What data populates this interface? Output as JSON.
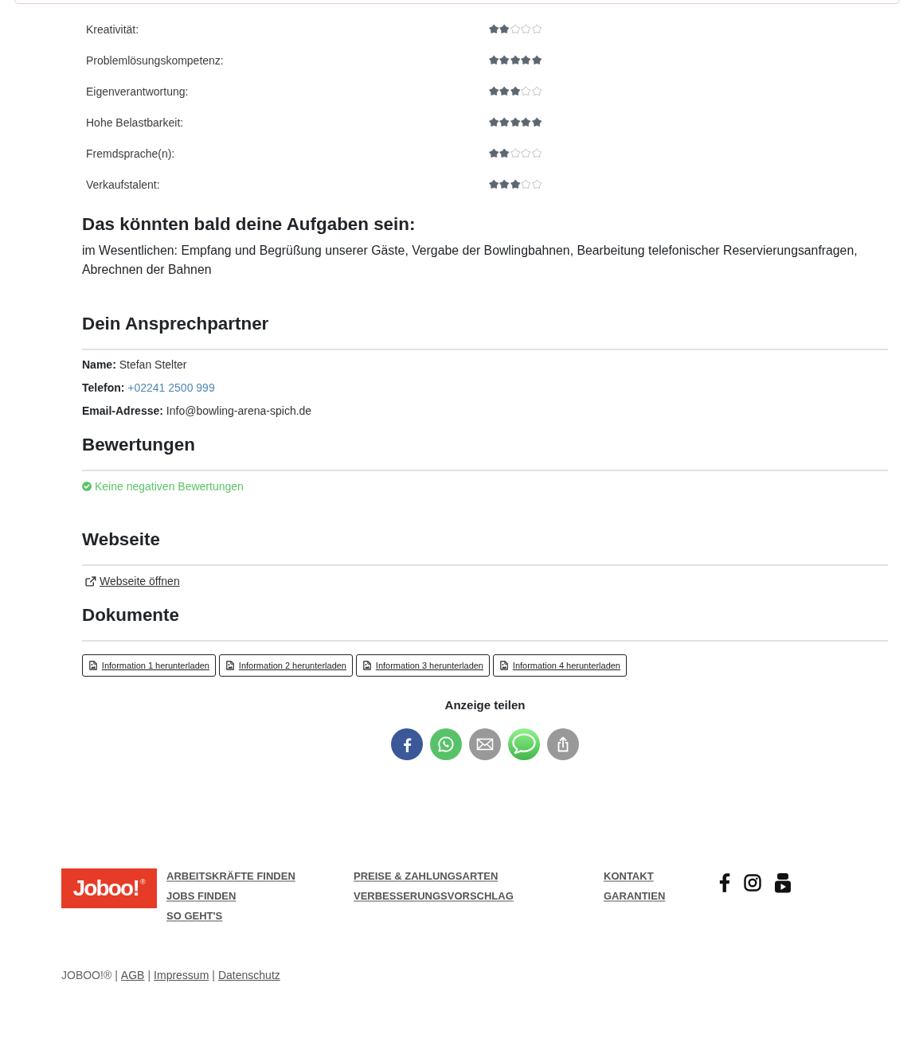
{
  "skills": [
    {
      "label": "Kreativität:",
      "stars": 2
    },
    {
      "label": "Problemlösungskompetenz:",
      "stars": 5
    },
    {
      "label": "Eigenverantwortung:",
      "stars": 3
    },
    {
      "label": "Hohe Belastbarkeit:",
      "stars": 5
    },
    {
      "label": "Fremdsprache(n):",
      "stars": 2
    },
    {
      "label": "Verkaufstalent:",
      "stars": 3
    }
  ],
  "tasks": {
    "heading": "Das könnten bald deine Aufgaben sein:",
    "text": "im Wesentlichen: Empfang und Begrüßung unserer Gäste, Vergabe der Bowlingbahnen, Bearbeitung telefonischer Reservierungsanfragen, Abrechnen der Bahnen"
  },
  "contact": {
    "heading": "Dein Ansprechpartner",
    "fields": [
      {
        "label": "Name:",
        "value": "Stefan Stelter",
        "kind": "text"
      },
      {
        "label": "Telefon:",
        "value": "+02241 2500 999",
        "kind": "link"
      },
      {
        "label": "Email-Adresse:",
        "value": "Info@bowling-arena-spich.de",
        "kind": "text"
      }
    ]
  },
  "reviews": {
    "heading": "Bewertungen",
    "status": "Keine negativen Bewertungen"
  },
  "website": {
    "heading": "Webseite",
    "link": "Webseite öffnen"
  },
  "documents": {
    "heading": "Dokumente",
    "buttons": [
      "Information 1 herunterladen",
      "Information 2 herunterladen",
      "Information 3 herunterladen",
      "Information 4 herunterladen"
    ]
  },
  "share": {
    "title": "Anzeige teilen",
    "buttons": [
      {
        "kind": "facebook"
      },
      {
        "kind": "whatsapp"
      },
      {
        "kind": "email"
      },
      {
        "kind": "message"
      },
      {
        "kind": "share"
      }
    ]
  },
  "footer": {
    "logo": "Joboo!$^{®}$",
    "columns": [
      {
        "links": [
          "ARBEITSKRÄFTE FINDEN",
          "JOBS FINDEN",
          "SO GEHT'S"
        ]
      },
      {
        "links": [
          "PREISE & ZAHLUNGSARTEN",
          "VERBESSERUNGSVORSCHLAG"
        ]
      },
      {
        "links": [
          "KONTAKT",
          "GARANTIEN"
        ]
      }
    ],
    "social": [
      {
        "kind": "facebook"
      },
      {
        "kind": "instagram"
      },
      {
        "kind": "youtube"
      }
    ]
  },
  "legal": {
    "brand": "JOBOO!®",
    "separator": "|",
    "links": [
      "AGB",
      "Impressum",
      "Datenschutz"
    ]
  }
}
